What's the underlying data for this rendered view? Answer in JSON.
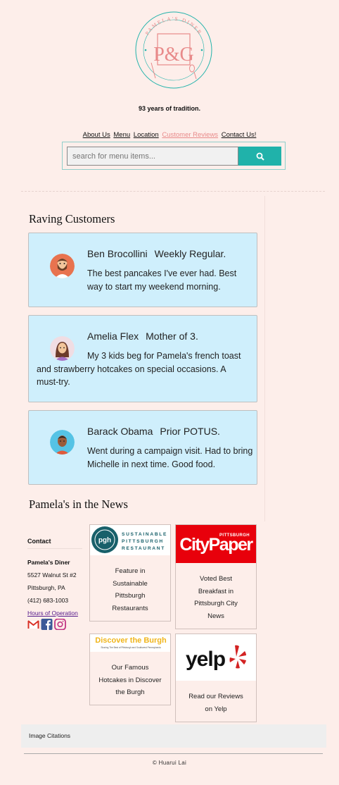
{
  "logo": {
    "arc_text": "PAMELA'S DINER",
    "monogram": "P&G"
  },
  "tagline": "93 years of tradition.",
  "nav": [
    {
      "label": "About Us",
      "active": false
    },
    {
      "label": "Menu",
      "active": false
    },
    {
      "label": "Location",
      "active": false
    },
    {
      "label": "Customer Reviews",
      "active": true
    },
    {
      "label": "Contact Us!",
      "active": false
    }
  ],
  "search": {
    "placeholder": "search for menu items...",
    "button_icon": "search-icon"
  },
  "reviews": {
    "heading": "Raving Customers",
    "items": [
      {
        "name": "Ben Brocollini",
        "role": "Weekly Regular.",
        "text": "The best pancakes I've ever had. Best way to start my weekend morning.",
        "avatar": "bearded-man-icon"
      },
      {
        "name": "Amelia Flex",
        "role": "Mother of 3.",
        "text": "My 3 kids beg for Pamela's french toast and strawberry hotcakes on special occasions. A must-try.",
        "avatar": "woman-icon"
      },
      {
        "name": "Barack Obama",
        "role": "Prior POTUS.",
        "text": "Went during a campaign visit. Had to bring Michelle in next time. Good food.",
        "avatar": "man-icon"
      }
    ]
  },
  "news": {
    "heading": "Pamela's in the News",
    "items": [
      {
        "logo_text": "SUSTAINABLE PITTSBURGH RESTAURANT",
        "badge": "pgh",
        "caption": "Feature in Sustainable Pittsburgh Restaurants"
      },
      {
        "logo_text": "CityPaper",
        "logo_sub": "PITTSBURGH",
        "caption": "Voted Best Breakfast in Pittsburgh City News"
      },
      {
        "logo_text": "Discover the Burgh",
        "logo_sub": "Sharing The Best of Pittsburgh and Southwest Pennsylvania",
        "caption": "Our Famous Hotcakes in Discover the Burgh"
      },
      {
        "logo_text": "yelp",
        "caption": "Read our Reviews on Yelp"
      }
    ]
  },
  "contact": {
    "heading": "Contact",
    "name": "Pamela's Diner",
    "street": "5527 Walnut St #2",
    "city": "Pittsburgh, PA",
    "phone": "(412) 683-1003",
    "hours_link": "Hours of Operation",
    "social": [
      "gmail-icon",
      "facebook-icon",
      "instagram-icon"
    ]
  },
  "footer": {
    "citations": "Image Citations",
    "copyright": "© Huarui Lai"
  },
  "colors": {
    "background": "#fdeeea",
    "teal": "#20b2aa",
    "pink": "#e88a8a",
    "card": "#cfeffc",
    "citypaper_red": "#e8000b",
    "yelp_red": "#d32323"
  }
}
